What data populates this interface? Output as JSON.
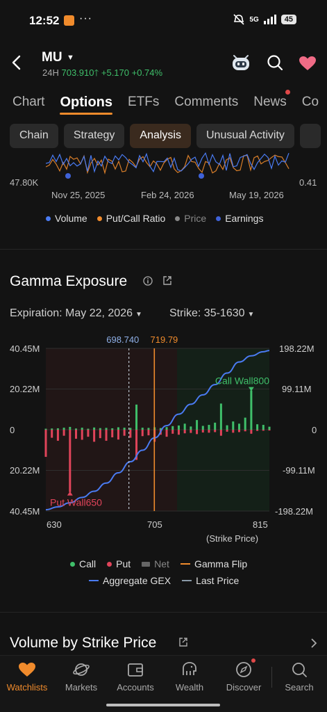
{
  "status": {
    "time": "12:52",
    "dots": "···",
    "network": "5G",
    "battery": "45"
  },
  "header": {
    "ticker": "MU",
    "session": "24H",
    "price": "703.910",
    "change": "+5.170",
    "change_pct": "+0.74%"
  },
  "tabs": [
    "Chart",
    "Options",
    "ETFs",
    "Comments",
    "News",
    "Co"
  ],
  "chips": [
    "Chain",
    "Strategy",
    "Analysis",
    "Unusual Activity"
  ],
  "mini_chart": {
    "y_left": "47.80K",
    "y_right": "0.41",
    "x_labels": [
      "Nov 25, 2025",
      "Feb 24, 2026",
      "May 19, 2026"
    ],
    "legend": [
      {
        "label": "Volume",
        "color": "#4a7bf2"
      },
      {
        "label": "Put/Call Ratio",
        "color": "#f08b2c"
      },
      {
        "label": "Price",
        "color": "#888888"
      },
      {
        "label": "Earnings",
        "color": "#3f62d8"
      }
    ]
  },
  "gamma": {
    "title": "Gamma Exposure",
    "expiration": "Expiration: May 22, 2026",
    "strike": "Strike: 35-1630",
    "last_price_label": "698.740",
    "flip_label": "719.79",
    "call_wall": "Call Wall800",
    "put_wall": "Put Wall650",
    "y_left": [
      "40.45M",
      "20.22M",
      "0",
      "20.22M",
      "40.45M"
    ],
    "y_right": [
      "198.22M",
      "99.11M",
      "0",
      "-99.11M",
      "-198.22M"
    ],
    "x_ticks": [
      "630",
      "705",
      "815"
    ],
    "x_title": "(Strike Price)",
    "legend_row1": [
      {
        "label": "Call",
        "color": "#3fbf6a"
      },
      {
        "label": "Put",
        "color": "#e0445a"
      },
      {
        "label": "Net",
        "color": "#777777"
      },
      {
        "label": "Gamma Flip",
        "color": "#f08b2c"
      }
    ],
    "legend_row2": [
      {
        "label": "Aggregate GEX",
        "color": "#4a7bf2"
      },
      {
        "label": "Last Price",
        "color": "#8a9aa8"
      }
    ]
  },
  "volume_section": {
    "title": "Volume by Strike Price"
  },
  "nav": [
    {
      "label": "Watchlists",
      "icon": "heart-icon"
    },
    {
      "label": "Markets",
      "icon": "planet-icon"
    },
    {
      "label": "Accounts",
      "icon": "wallet-icon"
    },
    {
      "label": "Wealth",
      "icon": "elephant-icon"
    },
    {
      "label": "Discover",
      "icon": "compass-icon"
    },
    {
      "label": "Search",
      "icon": "search-icon"
    }
  ],
  "chart_data": {
    "type": "bar",
    "title": "Gamma Exposure",
    "xlabel": "(Strike Price)",
    "xlim": [
      630,
      815
    ],
    "ylim": [
      -40.45,
      40.45
    ],
    "y2lim": [
      -198.22,
      198.22
    ],
    "last_price": 698.74,
    "gamma_flip": 719.79,
    "series": [
      {
        "name": "Call",
        "x": [
          630,
          635,
          640,
          645,
          650,
          655,
          660,
          665,
          670,
          675,
          680,
          685,
          690,
          695,
          700,
          705,
          710,
          715,
          720,
          725,
          730,
          735,
          740,
          745,
          750,
          755,
          760,
          765,
          770,
          775,
          780,
          785,
          790,
          795,
          800,
          805,
          810,
          815
        ],
        "values": [
          0.5,
          0.6,
          0.7,
          1.0,
          1.4,
          0.6,
          1.0,
          0.5,
          1.1,
          0.8,
          0.9,
          0.7,
          1.2,
          1.0,
          0.9,
          12.5,
          1.0,
          0.9,
          1.2,
          0.8,
          1.3,
          1.8,
          2.1,
          3.0,
          1.6,
          4.8,
          1.9,
          2.4,
          3.5,
          13.0,
          2.2,
          4.1,
          3.0,
          6.0,
          19.5,
          2.7,
          2.4,
          1.5
        ]
      },
      {
        "name": "Put",
        "x": [
          630,
          635,
          640,
          645,
          650,
          655,
          660,
          665,
          670,
          675,
          680,
          685,
          690,
          695,
          700,
          705,
          710,
          715,
          720,
          725,
          730,
          735,
          740,
          745,
          750,
          755,
          760,
          765,
          770,
          775,
          780,
          785,
          790,
          795,
          800,
          805,
          810,
          815
        ],
        "values": [
          -13.5,
          -4.0,
          -5.5,
          -3.0,
          -31.0,
          -4.5,
          -5.0,
          -3.5,
          -6.0,
          -4.2,
          -5.5,
          -3.8,
          -4.9,
          -3.0,
          -4.0,
          -15.0,
          -3.2,
          -2.8,
          -6.0,
          -2.5,
          -3.5,
          -2.0,
          -2.5,
          -1.8,
          -1.6,
          -2.2,
          -1.4,
          -1.5,
          -1.2,
          -3.0,
          -1.0,
          -1.5,
          -1.2,
          -0.8,
          -2.0,
          -0.6,
          -0.5,
          -0.4
        ]
      },
      {
        "name": "Aggregate GEX",
        "line": true,
        "x": [
          630,
          640,
          650,
          660,
          670,
          680,
          690,
          700,
          710,
          720,
          730,
          740,
          750,
          760,
          770,
          780,
          790,
          800,
          810,
          815
        ],
        "values": [
          -195,
          -188,
          -178,
          -165,
          -150,
          -130,
          -105,
          -78,
          -50,
          -20,
          10,
          38,
          62,
          85,
          110,
          138,
          165,
          180,
          190,
          193
        ]
      }
    ]
  }
}
